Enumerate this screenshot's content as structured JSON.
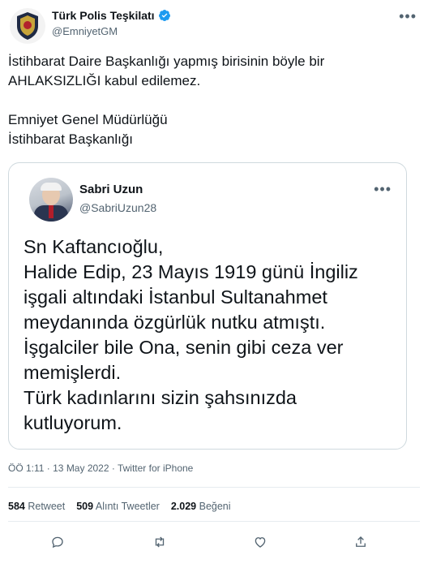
{
  "author": {
    "name": "Türk Polis Teşkilatı",
    "handle": "@EmniyetGM",
    "verified": true
  },
  "tweet": {
    "text": "İstihbarat Daire Başkanlığı yapmış birisinin böyle bir\nAHLAKSIZLIĞI kabul edilemez.\n\nEmniyet Genel Müdürlüğü\nİstihbarat Başkanlığı"
  },
  "quoted": {
    "name": "Sabri Uzun",
    "handle": "@SabriUzun28",
    "text": "Sn Kaftancıoğlu,\nHalide Edip, 23 Mayıs 1919 günü İngiliz\nişgali altındaki İstanbul Sultanahmet\nmeydanında özgürlük nutku atmıştı.\nİşgalciler bile Ona, senin gibi ceza ver\nmemişlerdi.\nTürk kadınlarını sizin şahsınızda\nkutluyorum."
  },
  "meta": {
    "timestamp": "ÖÖ 1:11 · 13 May 2022 · Twitter for iPhone"
  },
  "stats": {
    "retweet_count": "584",
    "retweet_label": "Retweet",
    "quote_count": "509",
    "quote_label": "Alıntı Tweetler",
    "like_count": "2.029",
    "like_label": "Beğeni"
  },
  "icons": {
    "verified": "verified-badge-icon",
    "more": "more-icon",
    "reply": "reply-icon",
    "retweet": "retweet-icon",
    "like": "like-icon",
    "share": "share-icon"
  },
  "colors": {
    "verified": "#1d9bf0",
    "text_primary": "#0f1419",
    "text_secondary": "#536471",
    "border": "#cfd9de"
  }
}
